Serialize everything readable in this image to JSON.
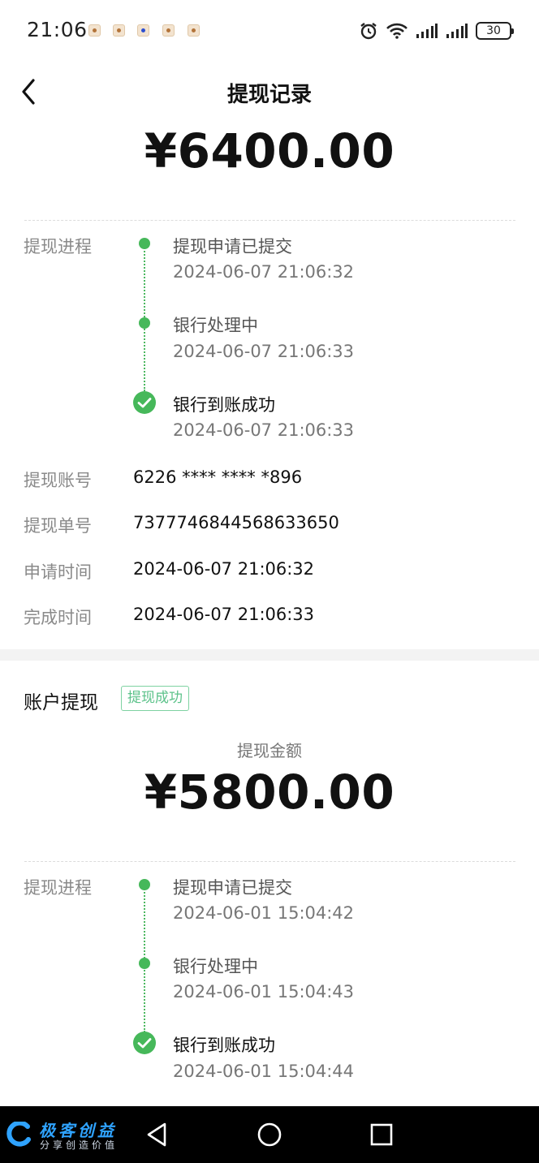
{
  "status_bar": {
    "time": "21:06",
    "battery": "30",
    "icons": [
      "alarm-icon",
      "wifi-icon",
      "signal-icon",
      "signal-icon"
    ]
  },
  "header": {
    "title": "提现记录"
  },
  "record1": {
    "amount": "¥6400.00",
    "progress_label": "提现进程",
    "steps": [
      {
        "title": "提现申请已提交",
        "time": "2024-06-07 21:06:32"
      },
      {
        "title": "银行处理中",
        "time": "2024-06-07 21:06:33"
      },
      {
        "title": "银行到账成功",
        "time": "2024-06-07 21:06:33"
      }
    ],
    "fields": [
      {
        "label": "提现账号",
        "value": "6226 **** **** *896"
      },
      {
        "label": "提现单号",
        "value": "7377746844568633650"
      },
      {
        "label": "申请时间",
        "value": "2024-06-07 21:06:32"
      },
      {
        "label": "完成时间",
        "value": "2024-06-07 21:06:33"
      }
    ]
  },
  "record2": {
    "title": "账户提现",
    "badge": "提现成功",
    "amount_label": "提现金额",
    "amount": "¥5800.00",
    "progress_label": "提现进程",
    "steps": [
      {
        "title": "提现申请已提交",
        "time": "2024-06-01 15:04:42"
      },
      {
        "title": "银行处理中",
        "time": "2024-06-01 15:04:43"
      },
      {
        "title": "银行到账成功",
        "time": "2024-06-01 15:04:44"
      }
    ]
  },
  "watermark": {
    "main": "极客创益",
    "sub": "分享创造价值"
  },
  "colors": {
    "accent_green": "#46b85a",
    "badge_green": "#5cc28a"
  }
}
